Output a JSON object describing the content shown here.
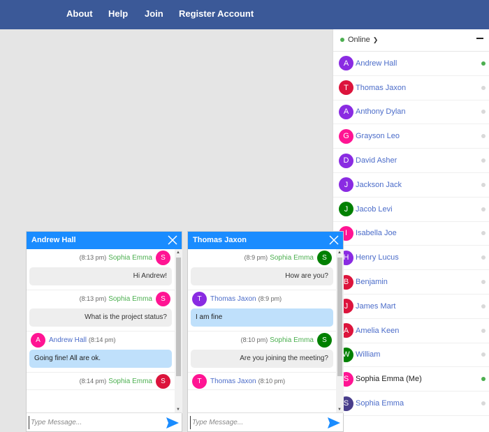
{
  "nav": {
    "links": [
      "About",
      "Help",
      "Join",
      "Register Account"
    ]
  },
  "colors": {
    "navbar": "#3b5998",
    "chat_header": "#1a8cff",
    "online": "#4caf50",
    "offline": "#d9d9d9"
  },
  "sidebar": {
    "status": "Online",
    "users": [
      {
        "initial": "A",
        "name": "Andrew Hall",
        "avatar_color": "#8a2be2",
        "online": true
      },
      {
        "initial": "T",
        "name": "Thomas Jaxon",
        "avatar_color": "#dc143c",
        "online": false
      },
      {
        "initial": "A",
        "name": "Anthony Dylan",
        "avatar_color": "#8a2be2",
        "online": false
      },
      {
        "initial": "G",
        "name": "Grayson Leo",
        "avatar_color": "#ff1493",
        "online": false
      },
      {
        "initial": "D",
        "name": "David Asher",
        "avatar_color": "#8a2be2",
        "online": false
      },
      {
        "initial": "J",
        "name": "Jackson Jack",
        "avatar_color": "#8a2be2",
        "online": false
      },
      {
        "initial": "J",
        "name": "Jacob Levi",
        "avatar_color": "#008000",
        "online": false
      },
      {
        "initial": "I",
        "name": "Isabella Joe",
        "avatar_color": "#ff1493",
        "online": false
      },
      {
        "initial": "H",
        "name": "Henry Lucus",
        "avatar_color": "#8a2be2",
        "online": false
      },
      {
        "initial": "B",
        "name": "Benjamin",
        "avatar_color": "#dc143c",
        "online": false
      },
      {
        "initial": "J",
        "name": "James Mart",
        "avatar_color": "#dc143c",
        "online": false
      },
      {
        "initial": "A",
        "name": "Amelia Keen",
        "avatar_color": "#dc143c",
        "online": false
      },
      {
        "initial": "W",
        "name": "William",
        "avatar_color": "#008000",
        "online": false
      },
      {
        "initial": "S",
        "name": "Sophia Emma (Me)",
        "avatar_color": "#ff1493",
        "online": true,
        "me": true
      },
      {
        "initial": "S",
        "name": "Sophia Emma",
        "avatar_color": "#483d8b",
        "online": false
      }
    ]
  },
  "chats": [
    {
      "title": "Andrew Hall",
      "placeholder": "Type Message...",
      "messages": [
        {
          "dir": "out",
          "name": "Sophia Emma",
          "time": "(8:13 pm)",
          "initial": "S",
          "avatar_color": "#ff1493",
          "text": "Hi Andrew!"
        },
        {
          "dir": "out",
          "name": "Sophia Emma",
          "time": "(8:13 pm)",
          "initial": "S",
          "avatar_color": "#ff1493",
          "text": "What is the project status?"
        },
        {
          "dir": "in",
          "name": "Andrew Hall",
          "time": "(8:14 pm)",
          "initial": "A",
          "avatar_color": "#ff1493",
          "text": "Going fine! All are ok."
        },
        {
          "dir": "out",
          "name": "Sophia Emma",
          "time": "(8:14 pm)",
          "initial": "S",
          "avatar_color": "#dc143c",
          "text": ""
        }
      ]
    },
    {
      "title": "Thomas Jaxon",
      "placeholder": "Type Message...",
      "messages": [
        {
          "dir": "out",
          "name": "Sophia Emma",
          "time": "(8:9 pm)",
          "initial": "S",
          "avatar_color": "#008000",
          "text": "How are you?"
        },
        {
          "dir": "in",
          "name": "Thomas Jaxon",
          "time": "(8:9 pm)",
          "initial": "T",
          "avatar_color": "#8a2be2",
          "text": "I am fine"
        },
        {
          "dir": "out",
          "name": "Sophia Emma",
          "time": "(8:10 pm)",
          "initial": "S",
          "avatar_color": "#008000",
          "text": "Are you joining the meeting?"
        },
        {
          "dir": "in",
          "name": "Thomas Jaxon",
          "time": "(8:10 pm)",
          "initial": "T",
          "avatar_color": "#ff1493",
          "text": ""
        }
      ]
    }
  ]
}
